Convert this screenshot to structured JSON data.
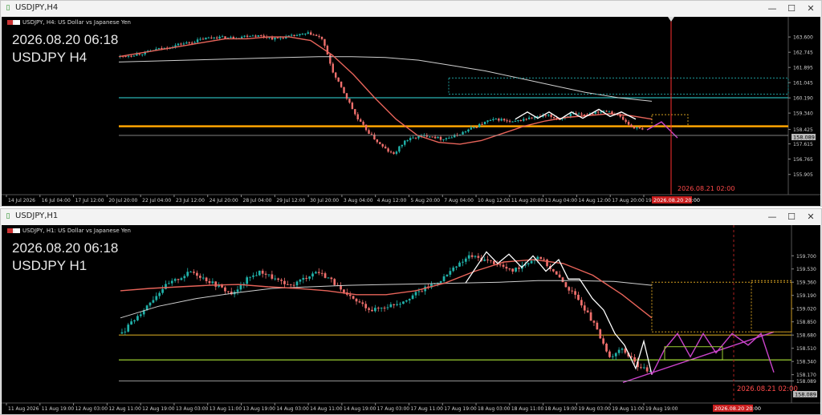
{
  "windows": [
    {
      "title": "USDJPY,H4",
      "header": "USDJPY, H4:  US Dollar vs Japanese Yen",
      "overlay_time": "2026.08.20 06:18",
      "overlay_symbol": "USDJPY H4",
      "vline_label": "2026.08.21 02:00",
      "time_marker": "2026.08.20 20:00",
      "price_marker": "158.089",
      "colors": {
        "bull": "#20b2aa",
        "bear": "#ef6f6c",
        "fast_ma": "#e8645a",
        "slow_ma": "#cfcfcf",
        "support": "#ffa500",
        "resistance": "#2ab3b3"
      }
    },
    {
      "title": "USDJPY,H1",
      "header": "USDJPY, H1:  US Dollar vs Japanese Yen",
      "overlay_time": "2026.08.20 06:18",
      "overlay_symbol": "USDJPY H1",
      "vline_label": "2026.08.21 02:00",
      "time_marker": "2026.08.20 20:00",
      "price_marker": "158.089",
      "colors": {
        "bull": "#20b2aa",
        "bear": "#ef6f6c",
        "fast_ma": "#e8645a",
        "slow_ma": "#cfcfcf",
        "support": "#9acd32",
        "resistance": "#c8a020",
        "projection": "#cc44cc"
      }
    }
  ],
  "chart_data": [
    {
      "type": "candlestick",
      "title": "USDJPY,H4",
      "ylim": [
        155.4,
        164.1
      ],
      "y_ticks": [
        "163.600",
        "162.745",
        "161.895",
        "161.045",
        "160.190",
        "159.340",
        "158.425",
        "157.615",
        "156.765",
        "155.905"
      ],
      "x_ticks": [
        "14 Jul 2026",
        "16 Jul 04:00",
        "17 Jul 12:00",
        "20 Jul 20:00",
        "22 Jul 04:00",
        "23 Jul 12:00",
        "24 Jul 20:00",
        "28 Jul 04:00",
        "29 Jul 12:00",
        "30 Jul 20:00",
        "3 Aug 04:00",
        "4 Aug 12:00",
        "5 Aug 20:00",
        "7 Aug 04:00",
        "10 Aug 12:00",
        "11 Aug 20:00",
        "13 Aug 04:00",
        "14 Aug 12:00",
        "17 Aug 20:00",
        "19 Aug 04:00"
      ],
      "close_path": [
        162.5,
        162.6,
        162.7,
        162.9,
        163.0,
        163.2,
        163.3,
        163.5,
        163.6,
        163.55,
        163.6,
        163.7,
        163.65,
        163.5,
        163.6,
        163.7,
        163.8,
        163.5,
        161.5,
        160.3,
        159.0,
        158.2,
        157.5,
        157.0,
        157.8,
        158.0,
        158.1,
        157.9,
        158.0,
        158.3,
        158.6,
        158.9,
        159.0,
        158.8,
        159.0,
        159.1,
        159.2,
        159.0,
        159.3,
        159.2,
        159.4,
        159.5,
        159.2,
        158.6,
        158.4
      ],
      "fast_ma": [
        162.5,
        162.7,
        162.9,
        163.1,
        163.3,
        163.5,
        163.5,
        163.6,
        163.6,
        163.4,
        162.6,
        161.5,
        160.2,
        159.0,
        158.1,
        157.7,
        157.6,
        157.8,
        158.2,
        158.6,
        158.9,
        159.1,
        159.2,
        159.3,
        159.2,
        159.0
      ],
      "slow_ma": [
        162.2,
        162.25,
        162.3,
        162.35,
        162.4,
        162.45,
        162.5,
        162.5,
        162.45,
        162.3,
        162.0,
        161.7,
        161.3,
        160.9,
        160.5,
        160.2,
        160.0
      ],
      "levels": [
        {
          "name": "resistance",
          "value": 160.2
        },
        {
          "name": "support",
          "value": 158.6
        }
      ]
    },
    {
      "type": "candlestick",
      "title": "USDJPY,H1",
      "ylim": [
        157.95,
        159.95
      ],
      "y_ticks": [
        "159.700",
        "159.530",
        "159.360",
        "159.190",
        "159.020",
        "158.850",
        "158.680",
        "158.510",
        "158.340",
        "158.170",
        "158.089"
      ],
      "x_ticks": [
        "11 Aug 2026",
        "11 Aug 19:00",
        "12 Aug 03:00",
        "12 Aug 11:00",
        "12 Aug 19:00",
        "13 Aug 03:00",
        "13 Aug 11:00",
        "13 Aug 19:00",
        "14 Aug 03:00",
        "14 Aug 11:00",
        "14 Aug 19:00",
        "17 Aug 03:00",
        "17 Aug 11:00",
        "17 Aug 19:00",
        "18 Aug 03:00",
        "18 Aug 11:00",
        "18 Aug 19:00",
        "19 Aug 03:00",
        "19 Aug 11:00",
        "19 Aug 19:00"
      ],
      "close_path": [
        158.7,
        158.9,
        159.1,
        159.3,
        159.4,
        159.5,
        159.4,
        159.3,
        159.2,
        159.4,
        159.5,
        159.4,
        159.3,
        159.4,
        159.5,
        159.4,
        159.2,
        159.1,
        159.0,
        159.05,
        159.1,
        159.2,
        159.3,
        159.4,
        159.55,
        159.7,
        159.65,
        159.6,
        159.5,
        159.6,
        159.7,
        159.5,
        159.3,
        159.1,
        158.8,
        158.4,
        158.5,
        158.3,
        158.2
      ],
      "fast_ma": [
        159.25,
        159.28,
        159.3,
        159.32,
        159.33,
        159.3,
        159.28,
        159.25,
        159.2,
        159.2,
        159.25,
        159.35,
        159.5,
        159.62,
        159.65,
        159.6,
        159.45,
        159.2,
        158.9
      ],
      "slow_ma": [
        158.9,
        159.05,
        159.15,
        159.22,
        159.28,
        159.3,
        159.32,
        159.33,
        159.34,
        159.35,
        159.36,
        159.38,
        159.38,
        159.37,
        159.32
      ],
      "levels": [
        {
          "name": "resistance",
          "value": 158.68
        },
        {
          "name": "support",
          "value": 158.36
        }
      ]
    }
  ]
}
